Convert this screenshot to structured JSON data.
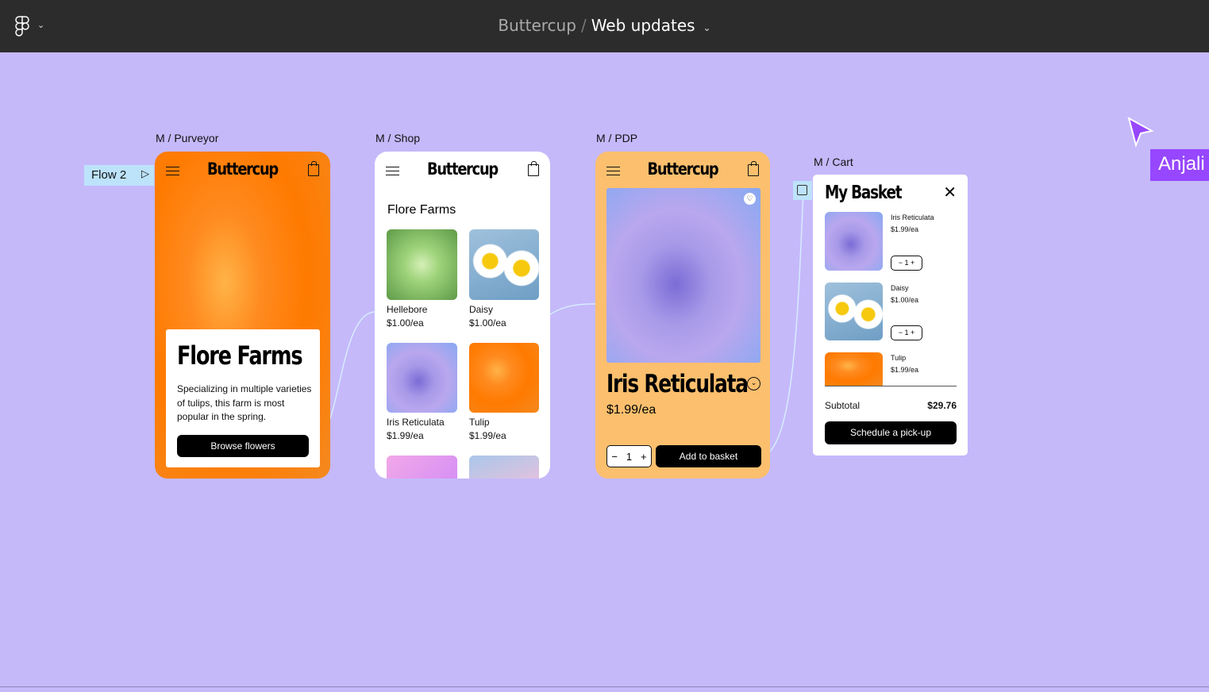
{
  "topbar": {
    "project": "Buttercup",
    "separator": "/",
    "file": "Web updates"
  },
  "frames": {
    "purveyor": {
      "label": "M / Purveyor",
      "brand": "Buttercup",
      "title": "Flore Farms",
      "description": "Specializing in multiple varieties of tulips, this farm is most popular in the spring.",
      "button": "Browse flowers"
    },
    "shop": {
      "label": "M / Shop",
      "brand": "Buttercup",
      "heading": "Flore Farms",
      "products": [
        {
          "name": "Hellebore",
          "price": "$1.00/ea"
        },
        {
          "name": "Daisy",
          "price": "$1.00/ea"
        },
        {
          "name": "Iris Reticulata",
          "price": "$1.99/ea"
        },
        {
          "name": "Tulip",
          "price": "$1.99/ea"
        }
      ]
    },
    "pdp": {
      "label": "M / PDP",
      "brand": "Buttercup",
      "title": "Iris Reticulata",
      "price": "$1.99/ea",
      "qty": "1",
      "button": "Add to basket"
    },
    "cart": {
      "label": "M / Cart",
      "title": "My Basket",
      "items": [
        {
          "name": "Iris Reticulata",
          "price": "$1.99/ea",
          "qty": "1"
        },
        {
          "name": "Daisy",
          "price": "$1.00/ea",
          "qty": "1"
        },
        {
          "name": "Tulip",
          "price": "$1.99/ea"
        }
      ],
      "subtotal_label": "Subtotal",
      "subtotal": "$29.76",
      "button": "Schedule a pick-up"
    }
  },
  "flow": {
    "label": "Flow 2"
  },
  "collaborator": {
    "name": "Anjali",
    "color": "#9747ff"
  },
  "colors": {
    "canvas": "#c5b9fa",
    "topbar": "#2c2c2c",
    "orange": "#ff7a00",
    "pdp_bg": "#fbbf6e",
    "flow_tag": "#bde3fb"
  }
}
